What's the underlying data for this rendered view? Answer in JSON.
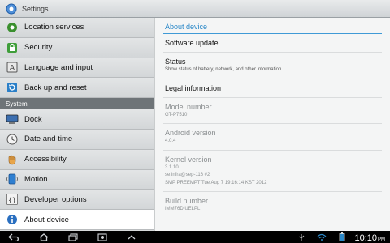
{
  "titlebar": {
    "title": "Settings",
    "icon": "settings-gear-icon"
  },
  "sidebar": {
    "items_top": [
      {
        "label": "Location services",
        "icon": "location-icon",
        "color": "#3a8f2e"
      },
      {
        "label": "Security",
        "icon": "lock-icon",
        "color": "#3f9e3a"
      },
      {
        "label": "Language and input",
        "icon": "keyboard-icon",
        "color": "#666666"
      },
      {
        "label": "Back up and reset",
        "icon": "backup-icon",
        "color": "#2a7fc8"
      }
    ],
    "section_label": "System",
    "items_system": [
      {
        "label": "Dock",
        "icon": "dock-icon"
      },
      {
        "label": "Date and time",
        "icon": "clock-icon"
      },
      {
        "label": "Accessibility",
        "icon": "hand-icon"
      },
      {
        "label": "Motion",
        "icon": "motion-icon"
      },
      {
        "label": "Developer options",
        "icon": "braces-icon"
      },
      {
        "label": "About device",
        "icon": "info-icon",
        "active": true
      }
    ]
  },
  "content": {
    "section_title": "About device",
    "software_update": "Software update",
    "status_title": "Status",
    "status_sub": "Show status of battery, network, and other information",
    "legal": "Legal information",
    "model_title": "Model number",
    "model_value": "GT-P7510",
    "android_title": "Android version",
    "android_value": "4.0.4",
    "kernel_title": "Kernel version",
    "kernel_line1": "3.1.10",
    "kernel_line2": "se.infra@sep-116 #2",
    "kernel_line3": "SMP PREEMPT Tue Aug 7 19:16:14 KST 2012",
    "build_title": "Build number",
    "build_value": "IMM76D.UELPL"
  },
  "navbar": {
    "time": "10:10",
    "ampm": "PM",
    "accent": "#2a88c8"
  }
}
